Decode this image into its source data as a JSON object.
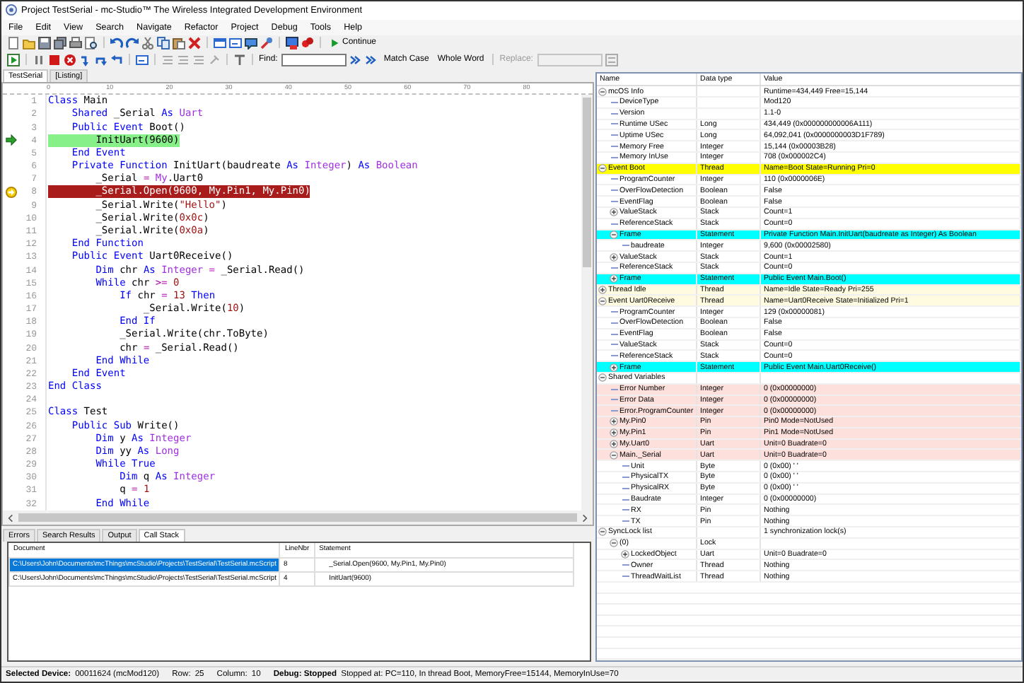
{
  "window": {
    "title": "Project TestSerial - mc-Studio™ The Wireless Integrated Development Environment"
  },
  "menu": [
    "File",
    "Edit",
    "View",
    "Search",
    "Navigate",
    "Refactor",
    "Project",
    "Debug",
    "Tools",
    "Help"
  ],
  "toolbar": {
    "continue": "Continue",
    "find": {
      "label": "Find:",
      "disabled": false
    },
    "search_options": [
      "Match Case",
      "Whole Word"
    ],
    "replace": {
      "label": "Replace:",
      "disabled": true
    }
  },
  "document_tabs": [
    {
      "label": "TestSerial",
      "selected": true
    },
    {
      "label": "[Listing]",
      "selected": false
    }
  ],
  "editor": {
    "ruler": [
      "0",
      "10",
      "20",
      "30",
      "40",
      "50",
      "60",
      "70",
      "80"
    ],
    "lines": [
      {
        "number": "1",
        "kind": "code",
        "tokens": [
          {
            "kind": "keyword",
            "text": "Class"
          },
          {
            "kind": "plain",
            "text": " Main"
          }
        ]
      },
      {
        "number": "2",
        "kind": "code",
        "tokens": [
          {
            "kind": "keyword",
            "text": "    Shared"
          },
          {
            "kind": "plain",
            "text": " _Serial "
          },
          {
            "kind": "keyword",
            "text": "As"
          },
          {
            "kind": "type",
            "text": " Uart"
          }
        ]
      },
      {
        "number": "3",
        "kind": "code",
        "tokens": [
          {
            "kind": "keyword",
            "text": "    Public Event"
          },
          {
            "kind": "plain",
            "text": " Boot()"
          }
        ]
      },
      {
        "number": "4",
        "kind": "frame",
        "tokens": [
          {
            "kind": "plain",
            "text": "        InitUart(9600)"
          }
        ]
      },
      {
        "number": "5",
        "kind": "code",
        "tokens": [
          {
            "kind": "keyword",
            "text": "    End Event"
          }
        ]
      },
      {
        "number": "6",
        "kind": "code",
        "tokens": [
          {
            "kind": "keyword",
            "text": "    Private Function"
          },
          {
            "kind": "plain",
            "text": " InitUart(baudreate "
          },
          {
            "kind": "keyword",
            "text": "As"
          },
          {
            "kind": "type",
            "text": " Integer"
          },
          {
            "kind": "plain",
            "text": ") "
          },
          {
            "kind": "keyword",
            "text": "As"
          },
          {
            "kind": "type",
            "text": " Boolean"
          }
        ]
      },
      {
        "number": "7",
        "kind": "code",
        "tokens": [
          {
            "kind": "plain",
            "text": "        _Serial "
          },
          {
            "kind": "operator",
            "text": "="
          },
          {
            "kind": "type",
            "text": " My"
          },
          {
            "kind": "plain",
            "text": ".Uart0"
          }
        ]
      },
      {
        "number": "8",
        "kind": "stopped",
        "tokens": [
          {
            "kind": "plain",
            "text": "        _Serial.Open(9600, My.Pin1, My.Pin0)"
          }
        ]
      },
      {
        "number": "9",
        "kind": "code",
        "tokens": [
          {
            "kind": "plain",
            "text": "        _Serial.Write("
          },
          {
            "kind": "string",
            "text": "\"Hello\""
          },
          {
            "kind": "plain",
            "text": ")"
          }
        ]
      },
      {
        "number": "10",
        "kind": "code",
        "tokens": [
          {
            "kind": "plain",
            "text": "        _Serial.Write("
          },
          {
            "kind": "number",
            "text": "0x0c"
          },
          {
            "kind": "plain",
            "text": ")"
          }
        ]
      },
      {
        "number": "11",
        "kind": "code",
        "tokens": [
          {
            "kind": "plain",
            "text": "        _Serial.Write("
          },
          {
            "kind": "number",
            "text": "0x0a"
          },
          {
            "kind": "plain",
            "text": ")"
          }
        ]
      },
      {
        "number": "12",
        "kind": "code",
        "tokens": [
          {
            "kind": "keyword",
            "text": "    End Function"
          }
        ]
      },
      {
        "number": "13",
        "kind": "code",
        "tokens": [
          {
            "kind": "keyword",
            "text": "    Public Event"
          },
          {
            "kind": "plain",
            "text": " Uart0Receive()"
          }
        ]
      },
      {
        "number": "14",
        "kind": "code",
        "tokens": [
          {
            "kind": "keyword",
            "text": "        Dim"
          },
          {
            "kind": "plain",
            "text": " chr "
          },
          {
            "kind": "keyword",
            "text": "As"
          },
          {
            "kind": "type",
            "text": " Integer"
          },
          {
            "kind": "operator",
            "text": " ="
          },
          {
            "kind": "plain",
            "text": " _Serial.Read()"
          }
        ]
      },
      {
        "number": "15",
        "kind": "code",
        "tokens": [
          {
            "kind": "keyword",
            "text": "        While"
          },
          {
            "kind": "plain",
            "text": " chr "
          },
          {
            "kind": "operator",
            "text": ">="
          },
          {
            "kind": "number",
            "text": " 0"
          }
        ]
      },
      {
        "number": "16",
        "kind": "code",
        "tokens": [
          {
            "kind": "keyword",
            "text": "            If"
          },
          {
            "kind": "plain",
            "text": " chr "
          },
          {
            "kind": "operator",
            "text": "="
          },
          {
            "kind": "number",
            "text": " 13"
          },
          {
            "kind": "keyword",
            "text": " Then"
          }
        ]
      },
      {
        "number": "17",
        "kind": "code",
        "tokens": [
          {
            "kind": "plain",
            "text": "                _Serial.Write("
          },
          {
            "kind": "number",
            "text": "10"
          },
          {
            "kind": "plain",
            "text": ")"
          }
        ]
      },
      {
        "number": "18",
        "kind": "code",
        "tokens": [
          {
            "kind": "keyword",
            "text": "            End If"
          }
        ]
      },
      {
        "number": "19",
        "kind": "code",
        "tokens": [
          {
            "kind": "plain",
            "text": "            _Serial.Write(chr.ToByte)"
          }
        ]
      },
      {
        "number": "20",
        "kind": "code",
        "tokens": [
          {
            "kind": "plain",
            "text": "            chr "
          },
          {
            "kind": "operator",
            "text": "="
          },
          {
            "kind": "plain",
            "text": " _Serial.Read()"
          }
        ]
      },
      {
        "number": "21",
        "kind": "code",
        "tokens": [
          {
            "kind": "keyword",
            "text": "        End While"
          }
        ]
      },
      {
        "number": "22",
        "kind": "code",
        "tokens": [
          {
            "kind": "keyword",
            "text": "    End Event"
          }
        ]
      },
      {
        "number": "23",
        "kind": "code",
        "tokens": [
          {
            "kind": "keyword",
            "text": "End Class"
          }
        ]
      },
      {
        "number": "24",
        "kind": "code"
      },
      {
        "number": "25",
        "kind": "code",
        "tokens": [
          {
            "kind": "keyword",
            "text": "Class"
          },
          {
            "kind": "plain",
            "text": " Test"
          }
        ]
      },
      {
        "number": "26",
        "kind": "code",
        "tokens": [
          {
            "kind": "keyword",
            "text": "    Public Sub"
          },
          {
            "kind": "plain",
            "text": " Write()"
          }
        ]
      },
      {
        "number": "27",
        "kind": "code",
        "tokens": [
          {
            "kind": "keyword",
            "text": "        Dim"
          },
          {
            "kind": "plain",
            "text": " y "
          },
          {
            "kind": "keyword",
            "text": "As"
          },
          {
            "kind": "type",
            "text": " Integer"
          }
        ]
      },
      {
        "number": "28",
        "kind": "code",
        "tokens": [
          {
            "kind": "keyword",
            "text": "        Dim"
          },
          {
            "kind": "plain",
            "text": " yy "
          },
          {
            "kind": "keyword",
            "text": "As"
          },
          {
            "kind": "type",
            "text": " Long"
          }
        ]
      },
      {
        "number": "29",
        "kind": "code",
        "tokens": [
          {
            "kind": "keyword",
            "text": "        While True"
          }
        ]
      },
      {
        "number": "30",
        "kind": "code",
        "tokens": [
          {
            "kind": "keyword",
            "text": "            Dim"
          },
          {
            "kind": "plain",
            "text": " q "
          },
          {
            "kind": "keyword",
            "text": "As"
          },
          {
            "kind": "type",
            "text": " Integer"
          }
        ]
      },
      {
        "number": "31",
        "kind": "code",
        "tokens": [
          {
            "kind": "plain",
            "text": "            q "
          },
          {
            "kind": "operator",
            "text": "="
          },
          {
            "kind": "number",
            "text": " 1"
          }
        ]
      },
      {
        "number": "32",
        "kind": "code",
        "tokens": [
          {
            "kind": "keyword",
            "text": "        End While"
          }
        ]
      }
    ]
  },
  "output_tabs": [
    {
      "label": "Errors",
      "selected": false
    },
    {
      "label": "Search Results",
      "selected": false
    },
    {
      "label": "Output",
      "selected": false
    },
    {
      "label": "Call Stack",
      "selected": true
    }
  ],
  "call_stack": {
    "columns": [
      "Document",
      "LineNbr",
      "Statement"
    ],
    "rows": [
      {
        "document": "C:\\Users\\John\\Documents\\mcThings\\mcStudio\\Projects\\TestSerial\\TestSerial.mcScript",
        "line": "8",
        "statement": "_Serial.Open(9600, My.Pin1, My.Pin0)",
        "selected": true
      },
      {
        "document": "C:\\Users\\John\\Documents\\mcThings\\mcStudio\\Projects\\TestSerial\\TestSerial.mcScript",
        "line": "4",
        "statement": "InitUart(9600)",
        "selected": false
      }
    ]
  },
  "watch": {
    "columns": [
      "Name",
      "Data type",
      "Value"
    ],
    "items": [
      {
        "name": "mcOS Info",
        "value": "Runtime=434,449   Free=15,144",
        "expanded": true,
        "children": [
          {
            "name": "DeviceType",
            "value": "Mod120"
          },
          {
            "name": "Version",
            "value": "1.1-0"
          },
          {
            "name": "Runtime USec",
            "data_type": "Long",
            "value": "434,449 (0x000000000006A111)"
          },
          {
            "name": "Uptime USec",
            "data_type": "Long",
            "value": "64,092,041 (0x0000000003D1F789)"
          },
          {
            "name": "Memory Free",
            "data_type": "Integer",
            "value": "15,144 (0x00003B28)"
          },
          {
            "name": "Memory InUse",
            "data_type": "Integer",
            "value": "708 (0x000002C4)"
          }
        ]
      },
      {
        "name": "Event Boot",
        "data_type": "Thread",
        "value": "Name=Boot State=Running  Pri=0",
        "expanded": true,
        "color": "#ffff00",
        "children": [
          {
            "name": "ProgramCounter",
            "data_type": "Integer",
            "value": "110 (0x0000006E)"
          },
          {
            "name": "OverFlowDetection",
            "data_type": "Boolean",
            "value": "False"
          },
          {
            "name": "EventFlag",
            "data_type": "Boolean",
            "value": "False"
          },
          {
            "name": "ValueStack",
            "data_type": "Stack",
            "value": "Count=1",
            "expanded": false
          },
          {
            "name": "ReferenceStack",
            "data_type": "Stack",
            "value": "Count=0"
          },
          {
            "name": "Frame",
            "data_type": "Statement",
            "value": "Private Function Main.InitUart(baudreate as Integer) As Boolean",
            "expanded": true,
            "color": "#00ffff",
            "children": [
              {
                "name": "baudreate",
                "data_type": "Integer",
                "value": "9,600 (0x00002580)"
              }
            ]
          },
          {
            "name": "ValueStack",
            "data_type": "Stack",
            "value": "Count=1",
            "expanded": false
          },
          {
            "name": "ReferenceStack",
            "data_type": "Stack",
            "value": "Count=0"
          },
          {
            "name": "Frame",
            "data_type": "Statement",
            "value": "Public Event Main.Boot()",
            "expanded": false,
            "color": "#00ffff"
          }
        ]
      },
      {
        "name": "Thread Idle",
        "data_type": "Thread",
        "value": "Name=Idle State=Ready  Pri=255",
        "expanded": false,
        "color": "#fffbe0"
      },
      {
        "name": "Event Uart0Receive",
        "data_type": "Thread",
        "value": "Name=Uart0Receive State=Initialized  Pri=1",
        "expanded": true,
        "color": "#fffbe0",
        "children": [
          {
            "name": "ProgramCounter",
            "data_type": "Integer",
            "value": "129 (0x00000081)"
          },
          {
            "name": "OverFlowDetection",
            "data_type": "Boolean",
            "value": "False"
          },
          {
            "name": "EventFlag",
            "data_type": "Boolean",
            "value": "False"
          },
          {
            "name": "ValueStack",
            "data_type": "Stack",
            "value": "Count=0"
          },
          {
            "name": "ReferenceStack",
            "data_type": "Stack",
            "value": "Count=0"
          },
          {
            "name": "Frame",
            "data_type": "Statement",
            "value": "Public Event Main.Uart0Receive()",
            "expanded": false,
            "color": "#00ffff"
          }
        ]
      },
      {
        "name": "Shared Variables",
        "expanded": true,
        "children": [
          {
            "name": "Error Number",
            "data_type": "Integer",
            "value": "0 (0x00000000)",
            "color": "#fde0dc"
          },
          {
            "name": "Error Data",
            "data_type": "Integer",
            "value": "0 (0x00000000)",
            "color": "#fde0dc"
          },
          {
            "name": "Error.ProgramCounter",
            "data_type": "Integer",
            "value": "0 (0x00000000)",
            "color": "#fde0dc"
          },
          {
            "name": "My.Pin0",
            "data_type": "Pin",
            "value": "Pin0 Mode=NotUsed",
            "expanded": false,
            "color": "#fde0dc"
          },
          {
            "name": "My.Pin1",
            "data_type": "Pin",
            "value": "Pin1 Mode=NotUsed",
            "expanded": false,
            "color": "#fde0dc"
          },
          {
            "name": "My.Uart0",
            "data_type": "Uart",
            "value": "Unit=0 Buadrate=0",
            "expanded": false,
            "color": "#fde0dc"
          },
          {
            "name": "Main._Serial",
            "data_type": "Uart",
            "value": "Unit=0 Buadrate=0",
            "expanded": true,
            "color": "#fde0dc",
            "children": [
              {
                "name": "Unit",
                "data_type": "Byte",
                "value": "0 (0x00) ' '"
              },
              {
                "name": "PhysicalTX",
                "data_type": "Byte",
                "value": "0 (0x00) ' '"
              },
              {
                "name": "PhysicalRX",
                "data_type": "Byte",
                "value": "0 (0x00) ' '"
              },
              {
                "name": "Baudrate",
                "data_type": "Integer",
                "value": "0 (0x00000000)"
              },
              {
                "name": "RX",
                "data_type": "Pin",
                "value": "Nothing"
              },
              {
                "name": "TX",
                "data_type": "Pin",
                "value": "Nothing"
              }
            ]
          }
        ]
      },
      {
        "name": "SyncLock list",
        "value": "1 synchronization lock(s)",
        "expanded": true,
        "children": [
          {
            "name": "(0)",
            "data_type": "Lock",
            "expanded": true,
            "children": [
              {
                "name": "LockedObject",
                "data_type": "Uart",
                "value": "Unit=0 Buadrate=0",
                "expanded": false
              },
              {
                "name": "Owner",
                "data_type": "Thread",
                "value": "Nothing"
              },
              {
                "name": "ThreadWaitList",
                "data_type": "Thread",
                "value": "Nothing"
              }
            ]
          }
        ]
      }
    ]
  },
  "status_bar": [
    {
      "label": "Selected Device:",
      "value": "00011624 (mcMod120)",
      "bold": true
    },
    {
      "label": "Row:",
      "value": "25",
      "bold": false
    },
    {
      "label": "Column:",
      "value": "10",
      "bold": false
    },
    {
      "label": "Debug: Stopped",
      "value": "Stopped at: PC=110,  In thread Boot,  MemoryFree=15144,  MemoryInUse=70",
      "bold": true
    }
  ]
}
